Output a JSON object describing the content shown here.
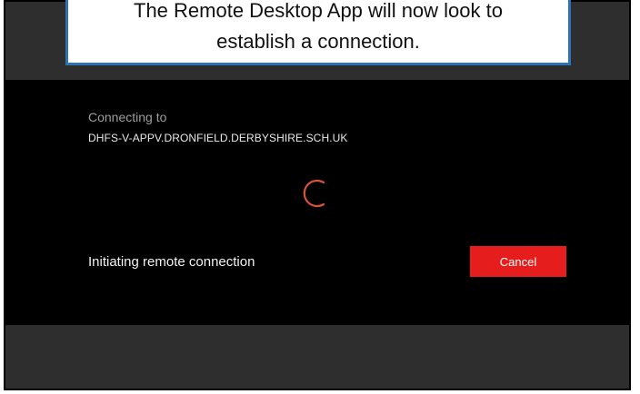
{
  "callout": {
    "line1": "The Remote Desktop App will now look to",
    "line2": "establish a connection."
  },
  "dialog": {
    "connecting_label": "Connecting to",
    "host": "DHFS-V-APPV.DRONFIELD.DERBYSHIRE.SCH.UK",
    "status": "Initiating remote connection",
    "cancel_label": "Cancel",
    "spinner_icon": "loading-spinner-icon"
  },
  "colors": {
    "accent": "#e51d1d",
    "spinner": "#d9533c",
    "callout_border": "#2e72b7"
  }
}
